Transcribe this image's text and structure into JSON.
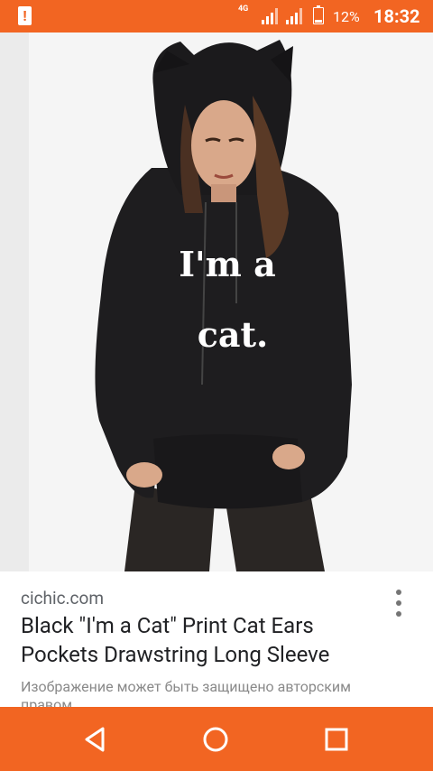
{
  "status_bar": {
    "network": "4G",
    "battery_percent": "12%",
    "time": "18:32"
  },
  "image": {
    "print_text_line1": "I'm a",
    "print_text_line2": "cat."
  },
  "result": {
    "domain": "cichic.com",
    "title": "Black \"I'm a Cat\" Print Cat Ears Pockets Drawstring Long Sleeve",
    "copyright_notice": "Изображение может быть защищено авторским правом."
  },
  "colors": {
    "accent": "#f26522",
    "title": "#202124",
    "secondary": "#5f6368"
  }
}
